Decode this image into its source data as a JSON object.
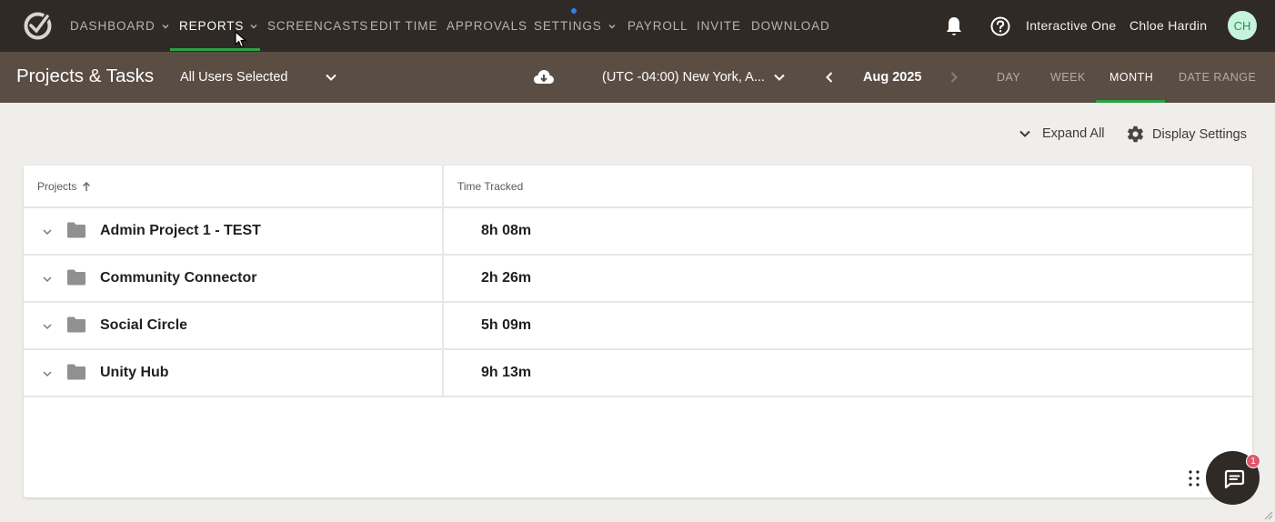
{
  "nav": {
    "items": [
      {
        "label": "DASHBOARD"
      },
      {
        "label": "REPORTS"
      },
      {
        "label": "SCREENCASTS"
      },
      {
        "label": "EDIT TIME"
      },
      {
        "label": "APPROVALS"
      },
      {
        "label": "SETTINGS"
      },
      {
        "label": "PAYROLL"
      },
      {
        "label": "INVITE"
      },
      {
        "label": "DOWNLOAD"
      }
    ],
    "active": "REPORTS",
    "org": "Interactive One",
    "user": "Chloe Hardin",
    "avatar_initials": "CH"
  },
  "subheader": {
    "title": "Projects & Tasks",
    "users_select": "All Users Selected",
    "timezone": "(UTC -04:00) New York, A...",
    "date": "Aug 2025",
    "ranges": [
      {
        "label": "DAY"
      },
      {
        "label": "WEEK"
      },
      {
        "label": "MONTH"
      },
      {
        "label": "DATE RANGE"
      }
    ],
    "active_range": "MONTH"
  },
  "toolbar": {
    "expand_label": "Expand All",
    "display_settings_label": "Display Settings"
  },
  "table": {
    "headers": {
      "projects": "Projects",
      "time": "Time Tracked"
    },
    "rows": [
      {
        "name": "Admin Project 1 - TEST",
        "time": "8h 08m"
      },
      {
        "name": "Community Connector",
        "time": "2h 26m"
      },
      {
        "name": "Social Circle",
        "time": "5h 09m"
      },
      {
        "name": "Unity Hub",
        "time": "9h 13m"
      }
    ]
  },
  "chat": {
    "badge": "1"
  },
  "colors": {
    "nav_bg": "#2f2a26",
    "subheader_bg": "#5a4d44",
    "accent": "#2ea043",
    "avatar_bg": "#c7f2dc"
  }
}
